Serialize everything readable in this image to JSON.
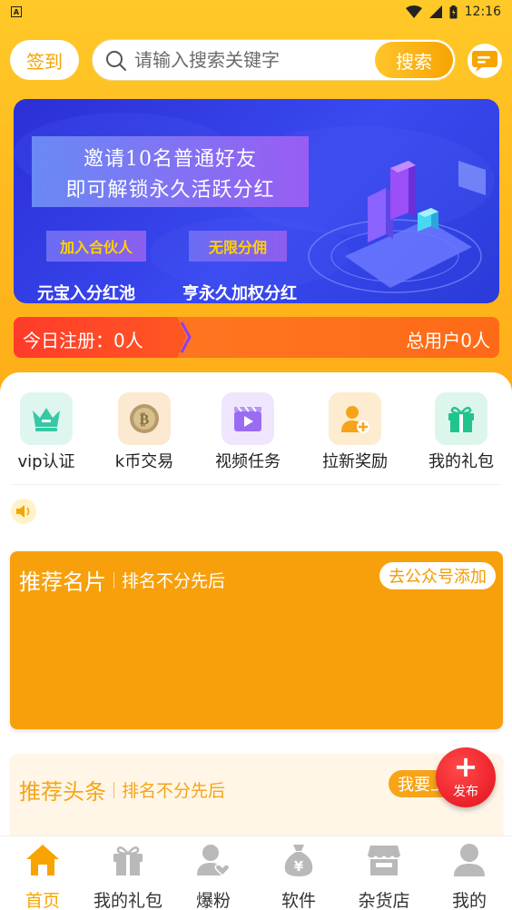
{
  "status_bar": {
    "time": "12:16",
    "app_glyph": "A"
  },
  "header": {
    "checkin_label": "签到",
    "search": {
      "placeholder": "请输入搜索关键字",
      "value": "",
      "button_label": "搜索"
    },
    "message_icon": "chat-bubble-icon"
  },
  "banner": {
    "line1": "邀请10名普通好友",
    "line2": "即可解锁永久活跃分红",
    "chip1": "加入合伙人",
    "chip2": "无限分佣",
    "bottom1": "元宝入分红池",
    "bottom2": "亨永久加权分红"
  },
  "stats": {
    "today_register": "今日注册：0人",
    "total_users": "总用户0人"
  },
  "quick_actions": [
    {
      "label": "vip认证",
      "icon": "crown-icon",
      "color": "#37c8a5"
    },
    {
      "label": "k币交易",
      "icon": "bitcoin-icon",
      "color": "#c7a46a"
    },
    {
      "label": "视频任务",
      "icon": "video-clapper-icon",
      "color": "#9a6cf2"
    },
    {
      "label": "拉新奖励",
      "icon": "add-user-icon",
      "color": "#f6a31b"
    },
    {
      "label": "我的礼包",
      "icon": "gift-icon",
      "color": "#22c48e"
    }
  ],
  "notice_icon": "speaker-icon",
  "recommend_card": {
    "title": "推荐名片",
    "subtitle": "排名不分先后",
    "action": "去公众号添加"
  },
  "news_card": {
    "title": "推荐头条",
    "subtitle": "排名不分先后",
    "action": "我要上头条"
  },
  "fab": {
    "label": "发布"
  },
  "bottom_nav": [
    {
      "label": "首页",
      "icon": "home-icon",
      "active": true
    },
    {
      "label": "我的礼包",
      "icon": "gift-icon",
      "active": false
    },
    {
      "label": "爆粉",
      "icon": "user-heart-icon",
      "active": false
    },
    {
      "label": "软件",
      "icon": "money-bag-icon",
      "active": false
    },
    {
      "label": "杂货店",
      "icon": "store-icon",
      "active": false
    },
    {
      "label": "我的",
      "icon": "profile-icon",
      "active": false
    }
  ],
  "colors": {
    "accent": "#f7a400",
    "banner": "#2b2fd6",
    "fab": "#e40f1d"
  }
}
